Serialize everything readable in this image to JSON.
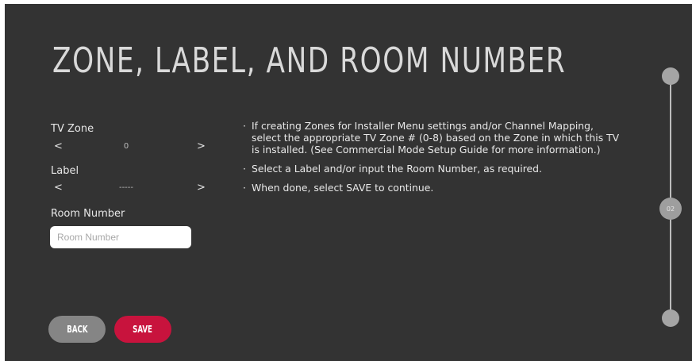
{
  "page": {
    "title": "ZONE, LABEL, AND ROOM NUMBER"
  },
  "tv_zone": {
    "label": "TV Zone",
    "value": "0",
    "prev_arrow": "<",
    "next_arrow": ">"
  },
  "label_field": {
    "label": "Label",
    "value": "-----",
    "prev_arrow": "<",
    "next_arrow": ">"
  },
  "room_number": {
    "label": "Room Number",
    "value": "",
    "placeholder": "Room Number"
  },
  "instructions": [
    "If creating Zones for Installer Menu settings and/or Channel Mapping, select the appropriate TV Zone # (0-8) based on the Zone in which this TV is installed. (See Commercial Mode Setup Guide for more information.)",
    "Select a Label and/or input the Room Number, as required.",
    "When done, select SAVE to continue."
  ],
  "instruction_bullet": "·",
  "buttons": {
    "back_label": "BACK",
    "save_label": "SAVE"
  },
  "progress": {
    "current_step": "02"
  },
  "colors": {
    "background": "#333333",
    "accent": "#c8133d",
    "secondary_button": "#858585"
  }
}
